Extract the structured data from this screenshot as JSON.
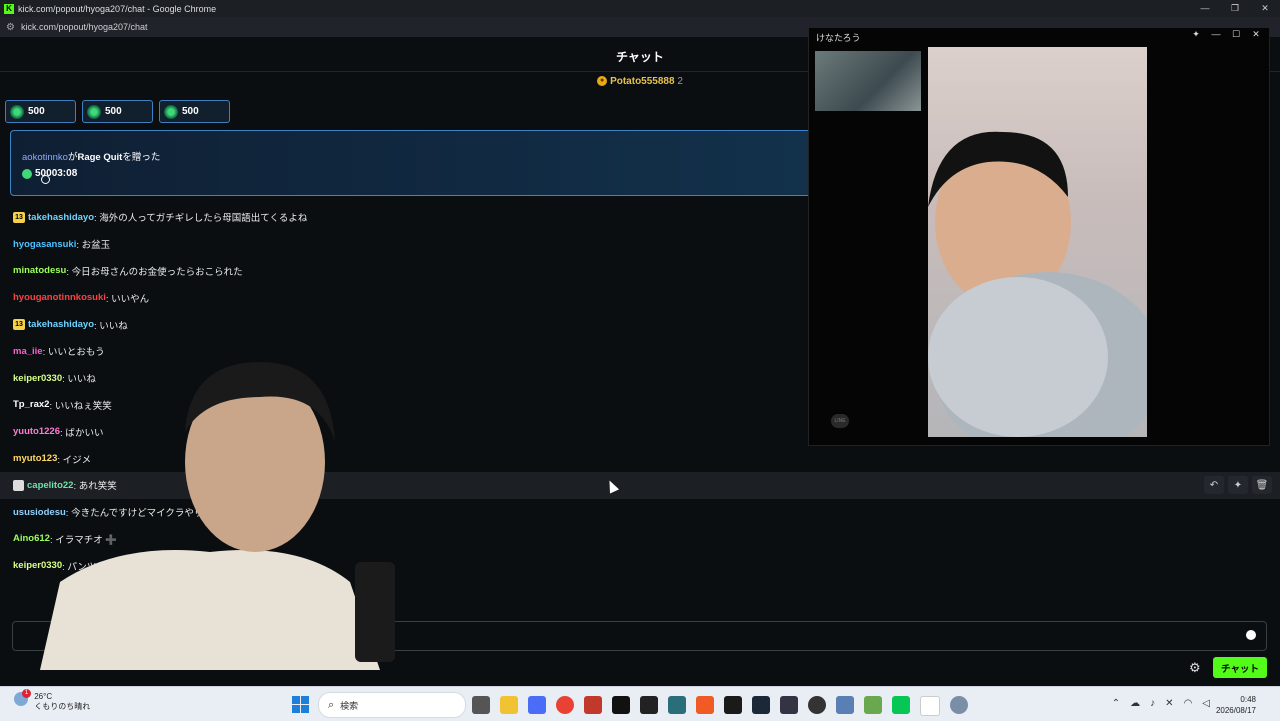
{
  "window": {
    "title": "kick.com/popout/hyoga207/chat - Google Chrome",
    "controls": [
      "—",
      "❐",
      "✕"
    ]
  },
  "url": "kick.com/popout/hyoga207/chat",
  "chat": {
    "header": "チャット",
    "pinned_user": {
      "name": "Potato555888",
      "count": "2"
    },
    "kick_pills": [
      {
        "value": "500"
      },
      {
        "value": "500"
      },
      {
        "value": "500"
      }
    ],
    "gift": {
      "user": "aokotinnko",
      "middle": "が",
      "item": "Rage Quit",
      "suffix": "を贈った",
      "amount": "500",
      "time": "03:08"
    },
    "messages": [
      {
        "badge": "13",
        "user": "takehashidayo",
        "color": "#6fd3ff",
        "text": ": 海外の人ってガチギレしたら母国語出てくるよね"
      },
      {
        "badge": "",
        "user": "hyogasansuki",
        "color": "#4fc3ff",
        "text": ": お盆玉"
      },
      {
        "badge": "",
        "user": "minatodesu",
        "color": "#9dff5a",
        "text": ": 今日お母さんのお金使ったらおこられた"
      },
      {
        "badge": "",
        "user": "hyouganotinnkosuki",
        "color": "#ff4040",
        "text": ": いいやん"
      },
      {
        "badge": "13",
        "user": "takehashidayo",
        "color": "#6fd3ff",
        "text": ": いいね"
      },
      {
        "badge": "",
        "user": "ma_iie",
        "color": "#ff5fd1",
        "text": ": いいとおもう"
      },
      {
        "badge": "",
        "user": "keiper0330",
        "color": "#d8ff8a",
        "text": ": いいね"
      },
      {
        "badge": "",
        "user": "Tp_rax2",
        "color": "#ffffff",
        "text": ": いいねぇ笑笑"
      },
      {
        "badge": "",
        "user": "yuuto1226",
        "color": "#ff7ad9",
        "text": ": ばかいい"
      },
      {
        "badge": "",
        "user": "myuto123",
        "color": "#ffd966",
        "text": ": イジメ"
      },
      {
        "badge": "avatar",
        "user": "capelito22",
        "color": "#6fe3a8",
        "text": ": あれ笑笑"
      },
      {
        "badge": "",
        "user": "ususiodesu",
        "color": "#8fd0ff",
        "text": ": 今きたんですけどマイクラやり"
      },
      {
        "badge": "",
        "user": "Aino612",
        "color": "#9dff5a",
        "text": ": イラマチオ ➕"
      },
      {
        "badge": "",
        "user": "keiper0330",
        "color": "#d8ff8a",
        "text": ": パンツだめでしょ"
      }
    ],
    "send_label": "チャット"
  },
  "popup": {
    "title": "けなたろう",
    "line_label": "LINE"
  },
  "taskbar": {
    "temp": "26°C",
    "weather": "くもりのち晴れ",
    "weather_badge": "1",
    "search_placeholder": "検索",
    "time": "0:48",
    "date": "2026/08/17"
  }
}
